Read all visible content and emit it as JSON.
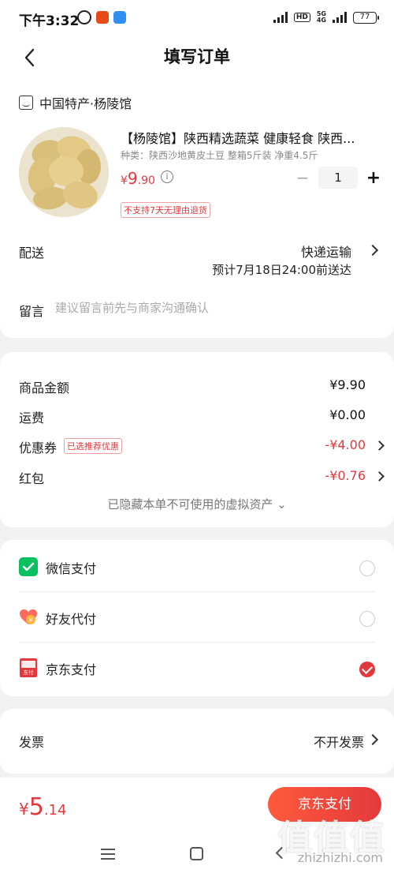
{
  "status_bar": {
    "time": "下午3:32",
    "net": "5G",
    "net_sub": "4G",
    "hd": "HD",
    "battery": "77"
  },
  "nav": {
    "title": "填写订单"
  },
  "shop": {
    "name": "中国特产·杨陵馆"
  },
  "product": {
    "title": "【杨陵馆】陕西精选蔬菜 健康轻食 陕西...",
    "spec": "种类：陕西沙地黄皮土豆 整箱5斤装 净重4.5斤",
    "price_currency": "¥",
    "price_int": "9",
    "price_dec": ".90",
    "quantity": "1",
    "minus": "−",
    "plus": "+",
    "return_tag": "不支持7天无理由退货"
  },
  "delivery": {
    "label": "配送",
    "method": "快递运输",
    "eta": "预计7月18日24:00前送达"
  },
  "message": {
    "label": "留言",
    "placeholder": "建议留言前先与商家沟通确认"
  },
  "summary": {
    "goods_label": "商品金额",
    "goods_value": "¥9.90",
    "shipping_label": "运费",
    "shipping_value": "¥0.00",
    "coupon_label": "优惠券",
    "coupon_tag": "已选推荐优惠",
    "coupon_value": "-¥4.00",
    "redpacket_label": "红包",
    "redpacket_value": "-¥0.76",
    "hidden_note": "已隐藏本单不可使用的虚拟资产 ⌄"
  },
  "payment": {
    "options": [
      {
        "label": "微信支付",
        "icon": "wechat-pay-icon",
        "selected": false
      },
      {
        "label": "好友代付",
        "icon": "friend-pay-icon",
        "selected": false
      },
      {
        "label": "京东支付",
        "icon": "jd-pay-icon",
        "selected": true
      }
    ]
  },
  "invoice": {
    "label": "发票",
    "value": "不开发票"
  },
  "footer": {
    "total_currency": "¥",
    "total_int": "5",
    "total_dec": ".14",
    "pay_button": "京东支付",
    "watermark": "值值值",
    "watermark_sub": "zhizhizhi.com"
  },
  "colors": {
    "accent": "#e4393c",
    "wechat": "#07c160"
  }
}
